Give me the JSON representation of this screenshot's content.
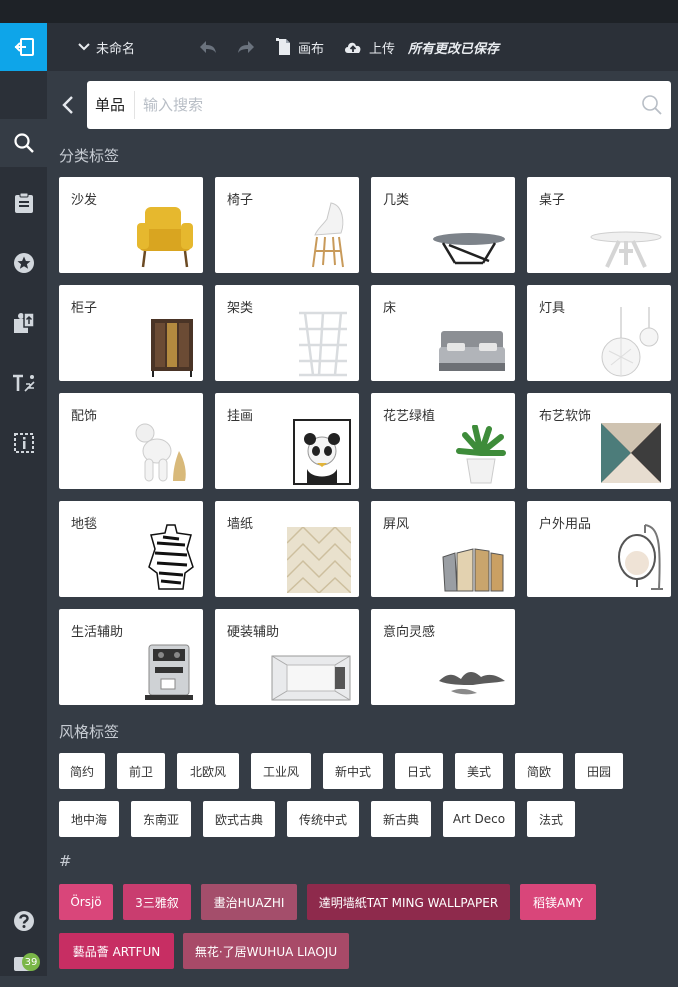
{
  "topbar": {
    "doc_name": "未命名",
    "canvas_label": "画布",
    "upload_label": "上传",
    "saved_status": "所有更改已保存"
  },
  "search": {
    "type_label": "单品",
    "placeholder": "输入搜索"
  },
  "category_section": {
    "title": "分类标签",
    "items": [
      {
        "label": "沙发",
        "icon": "sofa-chair"
      },
      {
        "label": "椅子",
        "icon": "chair"
      },
      {
        "label": "几类",
        "icon": "coffee-table"
      },
      {
        "label": "桌子",
        "icon": "table"
      },
      {
        "label": "柜子",
        "icon": "cabinet"
      },
      {
        "label": "架类",
        "icon": "shelf"
      },
      {
        "label": "床",
        "icon": "bed"
      },
      {
        "label": "灯具",
        "icon": "lamp"
      },
      {
        "label": "配饰",
        "icon": "ornament"
      },
      {
        "label": "挂画",
        "icon": "painting"
      },
      {
        "label": "花艺绿植",
        "icon": "plant"
      },
      {
        "label": "布艺软饰",
        "icon": "pillow"
      },
      {
        "label": "地毯",
        "icon": "rug"
      },
      {
        "label": "墙纸",
        "icon": "wallpaper"
      },
      {
        "label": "屏风",
        "icon": "screen"
      },
      {
        "label": "户外用品",
        "icon": "hanging-chair"
      },
      {
        "label": "生活辅助",
        "icon": "coffee-machine"
      },
      {
        "label": "硬装辅助",
        "icon": "room"
      },
      {
        "label": "意向灵感",
        "icon": "ink-landscape"
      }
    ]
  },
  "style_section": {
    "title": "风格标签",
    "tags": [
      "简约",
      "前卫",
      "北欧风",
      "工业风",
      "新中式",
      "日式",
      "美式",
      "简欧",
      "田园",
      "地中海",
      "东南亚",
      "欧式古典",
      "传统中式",
      "新古典",
      "Art Deco",
      "法式"
    ]
  },
  "brand_section": {
    "title": "#",
    "tags": [
      {
        "label": "Örsjö",
        "color": "#d9467a"
      },
      {
        "label": "3三雅叙",
        "color": "#c93d6f"
      },
      {
        "label": "畫治HUAZHI",
        "color": "#a44e6b"
      },
      {
        "label": "達明墙紙TAT MING WALLPAPER",
        "color": "#8e2a4c"
      },
      {
        "label": "稻镁AMY",
        "color": "#d9467a"
      },
      {
        "label": "藝品薈 ARTFUN",
        "color": "#c72e63"
      },
      {
        "label": "無花·了居WUHUA LIAOJU",
        "color": "#a84a68"
      }
    ]
  },
  "sidebar": {
    "badge_count": "39"
  }
}
